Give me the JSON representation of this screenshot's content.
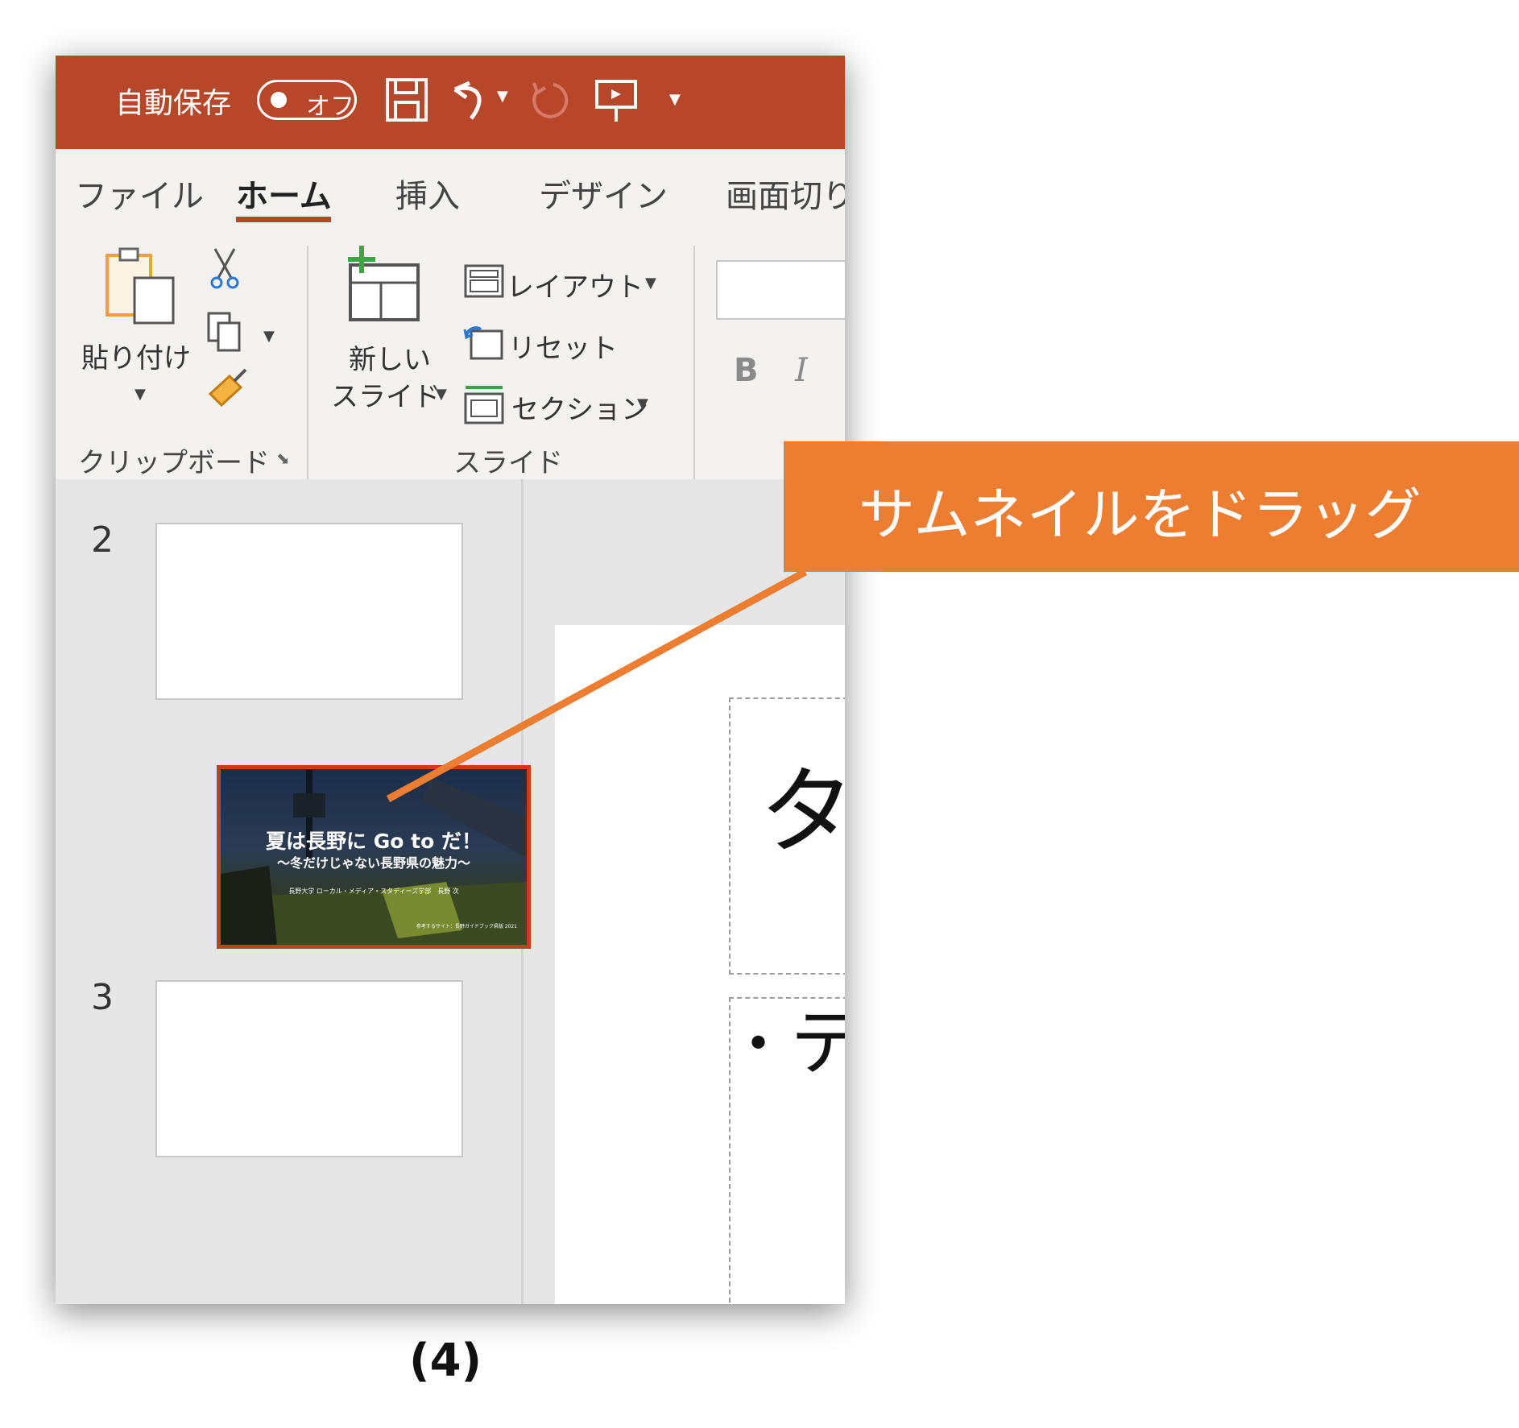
{
  "titlebar": {
    "autosave_label": "自動保存",
    "autosave_state": "オフ",
    "icons": [
      "save-icon",
      "undo-icon",
      "redo-icon",
      "present-icon",
      "customize-icon"
    ]
  },
  "tabs": [
    "ファイル",
    "ホーム",
    "挿入",
    "デザイン",
    "画面切り"
  ],
  "ribbon": {
    "paste_label": "貼り付け",
    "clipboard_group": "クリップボード",
    "new_slide_line1": "新しい",
    "new_slide_line2": "スライド",
    "layout_label": "レイアウト",
    "reset_label": "リセット",
    "section_label": "セクション",
    "slide_group": "スライド",
    "bold_label": "B",
    "italic_label": "I"
  },
  "thumbnails": {
    "slide2_number": "2",
    "slide3_number": "3",
    "dragged": {
      "title": "夏は長野に Go to だ！",
      "subtitle": "〜冬だけじゃない長野県の魅力〜",
      "author": "長野大学 ローカル・メディア・スタディーズ学部　長野 次",
      "footer": "参考するサイト：長野ガイドブック県版 2021"
    }
  },
  "main_slide": {
    "title_placeholder": "タ",
    "bullet": "•",
    "content_placeholder": "テ"
  },
  "callout": {
    "text": "サムネイルをドラッグ",
    "color": "#ed7d31"
  },
  "caption": "(4)",
  "colors": {
    "titlebar": "#b7472a",
    "accent": "#ed7d31",
    "selection": "#c43e1c"
  }
}
